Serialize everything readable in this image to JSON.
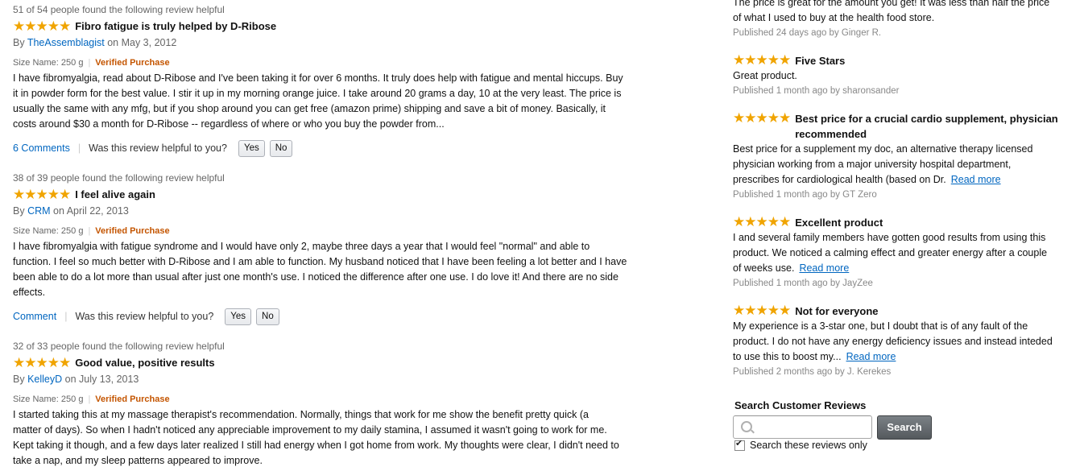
{
  "reviews": [
    {
      "helpful": "51 of 54 people found the following review helpful",
      "stars": "★★★★★",
      "title": "Fibro fatigue is truly helped by D-Ribose",
      "by": "By",
      "author": "TheAssemblagist",
      "on": "on May 3, 2012",
      "size": "Size Name: 250 g",
      "verified": "Verified Purchase",
      "body": [
        "I have fibromyalgia, read about D-Ribose and I've been taking it for over 6 months. It truly does help with fatigue and mental hiccups. Buy",
        "it in powder form for the best value. I stir it up in my morning orange juice. I take around 20 grams a day, 10 at the very least. The price is",
        "usually the same with any mfg, but if you shop around you can get free (amazon prime) shipping and save a bit of money. Basically, it",
        "costs around $30 a month for D-Ribose -- regardless of where or who you buy the powder from..."
      ],
      "comments": "6 Comments",
      "question": "Was this review helpful to you?",
      "yes": "Yes",
      "no": "No"
    },
    {
      "helpful": "38 of 39 people found the following review helpful",
      "stars": "★★★★★",
      "title": "I feel alive again",
      "by": "By",
      "author": "CRM",
      "on": "on April 22, 2013",
      "size": "Size Name: 250 g",
      "verified": "Verified Purchase",
      "body": [
        "I have fibromyalgia with fatigue syndrome and I would have only 2, maybe three days a year that I would feel \"normal\" and able to",
        "function. I feel so much better with D-Ribose and I am able to function. My husband noticed that I have been feeling a lot better and I have",
        "been able to do a lot more than usual after just one month's use. I noticed the difference after one use. I do love it! And there are no side",
        "effects."
      ],
      "comments": "Comment",
      "question": "Was this review helpful to you?",
      "yes": "Yes",
      "no": "No"
    },
    {
      "helpful": "32 of 33 people found the following review helpful",
      "stars": "★★★★★",
      "title": "Good value, positive results",
      "by": "By",
      "author": "KelleyD",
      "on": "on July 13, 2013",
      "size": "Size Name: 250 g",
      "verified": "Verified Purchase",
      "body": [
        "I started taking this at my massage therapist's recommendation. Normally, things that work for me show the benefit pretty quick (a",
        "matter of days). So when I hadn't noticed any appreciable improvement to my daily stamina, I assumed it wasn't going to work for me.",
        "Kept taking it though, and a few days later realized I still had energy when I got home from work. My thoughts were clear, I didn't need to",
        "take a nap, and my sleep patterns appeared to improve."
      ]
    }
  ],
  "recent": {
    "partial": {
      "body": [
        "The price is great for the amount you get! It was less than half the price",
        "of what I used to buy at the health food store."
      ],
      "published": "Published 24 days ago by Ginger R."
    },
    "items": [
      {
        "stars": "★★★★★",
        "title": "Five Stars",
        "body": [
          "Great product."
        ],
        "read_more": "",
        "published": "Published 1 month ago by sharonsander"
      },
      {
        "stars": "★★★★★",
        "title": "Best price for a crucial cardio supplement, physician recommended",
        "body": [
          "Best price for a supplement my doc, an alternative therapy licensed",
          "physician working from a major university hospital department,",
          "prescribes for cardiological health (based on Dr."
        ],
        "read_more": "Read more",
        "published": "Published 1 month ago by GT Zero"
      },
      {
        "stars": "★★★★★",
        "title": "Excellent product",
        "body": [
          "I and several family members have gotten good results from using this",
          "product. We noticed a calming effect and greater energy after a couple",
          "of weeks use."
        ],
        "read_more": "Read more",
        "published": "Published 1 month ago by JayZee"
      },
      {
        "stars": "★★★★★",
        "title": "Not for everyone",
        "body": [
          "My experience is a 3-star one, but I doubt that is of any fault of the",
          "product. I do not have any energy deficiency issues and instead inteded",
          "to use this to boost my..."
        ],
        "read_more": "Read more",
        "published": "Published 2 months ago by J. Kerekes"
      }
    ]
  },
  "search": {
    "label": "Search Customer Reviews",
    "value": "",
    "button": "Search",
    "only_label": "Search these reviews only",
    "only_checked": true
  },
  "colors": {
    "star": "#f0a400",
    "link": "#0066c0",
    "verified": "#c45500"
  }
}
